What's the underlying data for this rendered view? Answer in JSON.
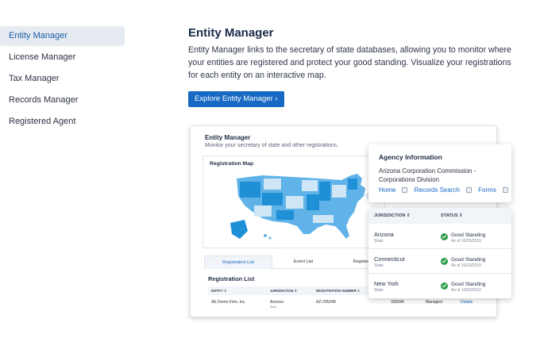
{
  "sidebar": {
    "items": [
      {
        "label": "Entity Manager",
        "active": true
      },
      {
        "label": "License Manager"
      },
      {
        "label": "Tax Manager"
      },
      {
        "label": "Records Manager"
      },
      {
        "label": "Registered Agent"
      }
    ]
  },
  "main": {
    "title": "Entity Manager",
    "description": "Entity Manager links to the secretary of state databases, allowing you to monitor where your entities are registered and protect your good standing. Visualize your registrations for each entity on an interactive map.",
    "cta_label": "Explore Entity Manager ›"
  },
  "preview": {
    "title": "Entity Manager",
    "subtitle": "Monitor your secretary of state and other registrations.",
    "map_title": "Registration Map",
    "tabs": [
      "Registration List",
      "Event List",
      "Registered Ag"
    ],
    "registration_list_title": "Registration List",
    "grid_headers": [
      "ENTITY ⇕",
      "JURISDICTION ⇕",
      "REGISTRATION NUMBER ⇕"
    ],
    "grid_row": {
      "entity": "AE Demo Firm, Inc.",
      "jurisdiction": "Arizona",
      "jurisdiction_type": "State",
      "registration_number": "AZ-295348",
      "number2": "332044",
      "managed": "Managed",
      "details": "Details"
    }
  },
  "agency": {
    "title": "Agency Information",
    "body": "Arizona Corporation Commission - Corporations Division",
    "links": [
      "Home",
      "Records Search",
      "Forms"
    ]
  },
  "jurisdictions": {
    "headers": [
      "JURISDICTION ⇕",
      "STATUS ⇕"
    ],
    "rows": [
      {
        "name": "Arizona",
        "type": "State",
        "status": "Good Standing",
        "date": "As of 10/23/2019"
      },
      {
        "name": "Connecticut",
        "type": "State",
        "status": "Good Standing",
        "date": "As of 10/23/2019"
      },
      {
        "name": "New York",
        "type": "State",
        "status": "Good Standing",
        "date": "As of 10/23/2019"
      }
    ]
  },
  "colors": {
    "accent": "#1769c4",
    "map_light": "#cfe6f7",
    "map_mid": "#5fb3e8",
    "map_dark": "#1f8fd6",
    "success": "#2e9d4a"
  }
}
